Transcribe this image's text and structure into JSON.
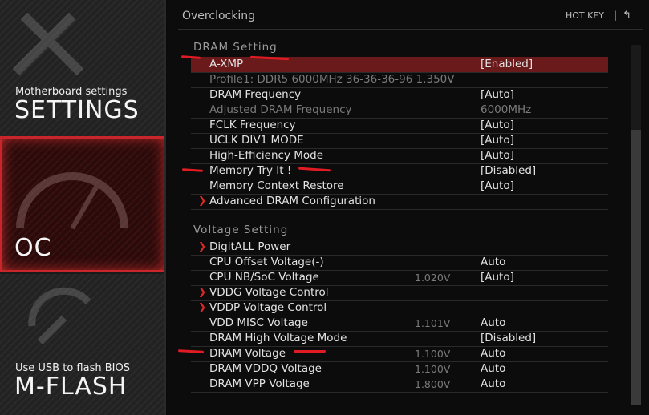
{
  "sidebar": {
    "settings": {
      "subtitle": "Motherboard settings",
      "title": "SETTINGS"
    },
    "oc": {
      "title": "OC"
    },
    "mflash": {
      "subtitle": "Use USB to flash BIOS",
      "title": "M-FLASH"
    }
  },
  "header": {
    "breadcrumb": "Overclocking",
    "hotkey": "HOT KEY",
    "separator": "|",
    "back_glyph": "↰"
  },
  "dram_section": {
    "title": "DRAM  Setting",
    "rows": [
      {
        "label": "A-XMP",
        "mid": "",
        "value": "[Enabled]"
      },
      {
        "label": "Profile1: DDR5 6000MHz 36-36-36-96 1.350V",
        "mid": "",
        "value": ""
      },
      {
        "label": "DRAM Frequency",
        "mid": "",
        "value": "[Auto]"
      },
      {
        "label": "Adjusted DRAM Frequency",
        "mid": "",
        "value": "6000MHz"
      },
      {
        "label": "FCLK Frequency",
        "mid": "",
        "value": "[Auto]"
      },
      {
        "label": "UCLK DIV1 MODE",
        "mid": "",
        "value": "[Auto]"
      },
      {
        "label": "High-Efficiency Mode",
        "mid": "",
        "value": "[Auto]"
      },
      {
        "label": "Memory Try It !",
        "mid": "",
        "value": "[Disabled]"
      },
      {
        "label": "Memory Context Restore",
        "mid": "",
        "value": "[Auto]"
      },
      {
        "label": "Advanced DRAM Configuration",
        "mid": "",
        "value": ""
      }
    ]
  },
  "voltage_section": {
    "title": "Voltage  Setting",
    "rows": [
      {
        "label": "DigitALL Power",
        "mid": "",
        "value": ""
      },
      {
        "label": "CPU Offset Voltage(-)",
        "mid": "",
        "value": "Auto"
      },
      {
        "label": "CPU NB/SoC Voltage",
        "mid": "1.020V",
        "value": "[Auto]"
      },
      {
        "label": "VDDG Voltage Control",
        "mid": "",
        "value": ""
      },
      {
        "label": "VDDP Voltage Control",
        "mid": "",
        "value": ""
      },
      {
        "label": "VDD MISC Voltage",
        "mid": "1.101V",
        "value": "Auto"
      },
      {
        "label": "DRAM High Voltage Mode",
        "mid": "",
        "value": "[Disabled]"
      },
      {
        "label": "DRAM Voltage",
        "mid": "1.100V",
        "value": "Auto"
      },
      {
        "label": "DRAM VDDQ Voltage",
        "mid": "1.100V",
        "value": "Auto"
      },
      {
        "label": "DRAM VPP Voltage",
        "mid": "1.800V",
        "value": "Auto"
      }
    ]
  },
  "colors": {
    "accent": "#e0262a",
    "selected_row": "#6a1a1a",
    "annotation": "#e01b24"
  },
  "icons": {
    "submenu": "chevron-right-icon",
    "back": "back-arrow-icon"
  }
}
